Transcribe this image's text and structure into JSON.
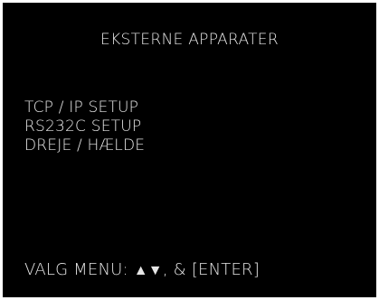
{
  "title": "EKSTERNE APPARATER",
  "menu": {
    "items": [
      {
        "label": "TCP / IP SETUP"
      },
      {
        "label": "RS232C SETUP"
      },
      {
        "label": "DREJE / HÆLDE"
      }
    ]
  },
  "hint": {
    "prefix": "VALG MENU: ",
    "up_arrow": "▲",
    "down_arrow": "▼",
    "separator": ", & ",
    "enter_label": "[ENTER]"
  },
  "colors": {
    "background": "#000000",
    "text": "#e6e6e6"
  }
}
